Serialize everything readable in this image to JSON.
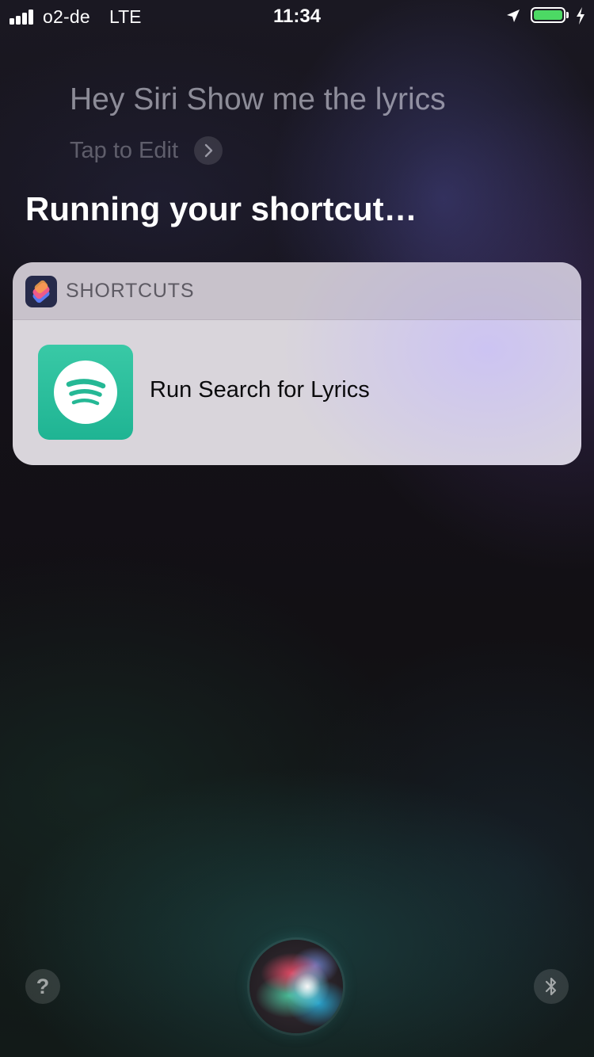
{
  "status_bar": {
    "carrier": "o2-de",
    "network": "LTE",
    "time": "11:34",
    "signal_bars": 4,
    "battery_fill_percent": 100,
    "battery_color": "#4cd964",
    "icons": [
      "signal-icon",
      "location-arrow-icon",
      "battery-icon",
      "charging-bolt-icon"
    ]
  },
  "siri": {
    "query": "Hey Siri Show me the lyrics",
    "tap_to_edit": "Tap to Edit",
    "response_title": "Running your shortcut…"
  },
  "card": {
    "app_name": "SHORTCUTS",
    "app_icon": "shortcuts-app-icon",
    "shortcut_label": "Run Search for Lyrics",
    "shortcut_icon": "spotify-icon",
    "shortcut_icon_color": "#1fb493"
  },
  "bottom": {
    "help_label": "?",
    "icons": [
      "help-icon",
      "siri-orb",
      "bluetooth-icon"
    ]
  }
}
